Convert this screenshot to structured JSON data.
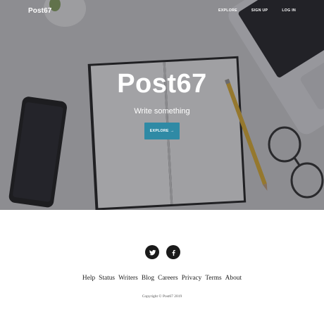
{
  "header": {
    "brand": "Post67",
    "nav": [
      {
        "label": "EXPLORE"
      },
      {
        "label": "SIGN UP"
      },
      {
        "label": "LOG IN"
      }
    ]
  },
  "hero": {
    "title": "Post67",
    "subtitle": "Write something",
    "button_label": "EXPLORE",
    "button_arrow": "→"
  },
  "footer": {
    "social": [
      {
        "name": "twitter"
      },
      {
        "name": "facebook"
      }
    ],
    "links": [
      "Help",
      "Status",
      "Writers",
      "Blog",
      "Careers",
      "Privacy",
      "Terms",
      "About"
    ],
    "copyright": "Copyright © Post67 2019"
  },
  "colors": {
    "button": "#2f8aa5",
    "overlay": "rgba(40,40,48,0.42)",
    "social_circle": "#1a1a1a"
  }
}
